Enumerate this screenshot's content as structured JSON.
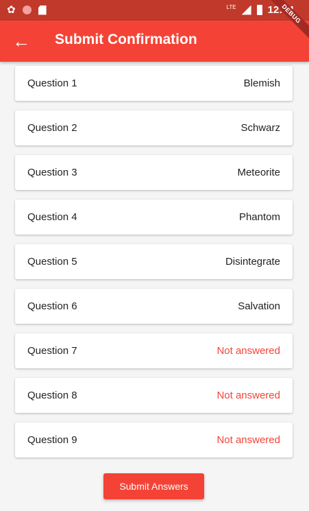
{
  "status_bar": {
    "time": "12:04",
    "network": "LTE",
    "icons": [
      "settings-icon",
      "record-icon",
      "sd-card-icon",
      "signal-icon",
      "battery-icon"
    ]
  },
  "app_bar": {
    "title": "Submit Confirmation",
    "back_icon": "arrow-back-icon",
    "color": "#f44336"
  },
  "debug_banner": "DEBUG",
  "questions": [
    {
      "label": "Question 1",
      "answer": "Blemish",
      "answered": true
    },
    {
      "label": "Question 2",
      "answer": "Schwarz",
      "answered": true
    },
    {
      "label": "Question 3",
      "answer": "Meteorite",
      "answered": true
    },
    {
      "label": "Question 4",
      "answer": "Phantom",
      "answered": true
    },
    {
      "label": "Question 5",
      "answer": "Disintegrate",
      "answered": true
    },
    {
      "label": "Question 6",
      "answer": "Salvation",
      "answered": true
    },
    {
      "label": "Question 7",
      "answer": "Not answered",
      "answered": false
    },
    {
      "label": "Question 8",
      "answer": "Not answered",
      "answered": false
    },
    {
      "label": "Question 9",
      "answer": "Not answered",
      "answered": false
    }
  ],
  "submit_label": "Submit Answers",
  "colors": {
    "accent": "#f44336",
    "status_bar": "#c0392b",
    "unanswered": "#f44336"
  }
}
